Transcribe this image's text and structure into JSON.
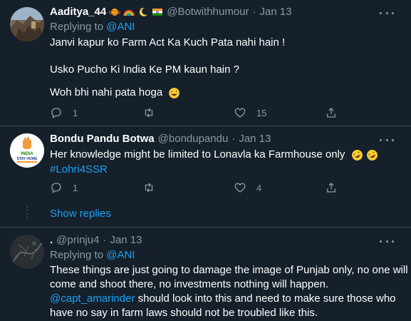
{
  "tweets": [
    {
      "display_name": "Aaditya_44",
      "name_emojis": [
        "ringed-planet",
        "rainbow",
        "crescent-moon",
        "india-flag"
      ],
      "handle": "@Botwithhumour",
      "date": "Jan 13",
      "replying_label": "Replying to",
      "replying_to": "@ANI",
      "lines": [
        "Janvi kapur ko Farm Act Ka Kuch Pata nahi hain !",
        "Usko Pucho Ki India Ke PM kaun hain ?",
        "Woh bhi nahi pata hoga"
      ],
      "reply_count": "1",
      "retweet_count": "",
      "like_count": "15"
    },
    {
      "display_name": "Bondu Pandu Botwa",
      "handle": "@bondupandu",
      "date": "Jan 13",
      "avatar_text": [
        "INDIA",
        "STAY HOME"
      ],
      "line1": "Her knowledge might be limited to Lonavla ka Farmhouse only",
      "hashtag": "#Lohri4SSR",
      "reply_count": "1",
      "retweet_count": "",
      "like_count": "4"
    },
    {
      "display_name": ".",
      "handle": "@prinju4",
      "date": "Jan 13",
      "replying_label": "Replying to",
      "replying_to": "@ANI",
      "lines": [
        "These things are just going to damage the image of Punjab only, no one will",
        "come and shoot there, no investments nothing will happen."
      ],
      "mention": "@capt_amarinder",
      "mention_rest": " should look into this and need to make sure those who",
      "last_line": "have no say in farm laws should not be troubled like this."
    }
  ],
  "show_replies_label": "Show replies",
  "separator": "·",
  "colors": {
    "background": "#15202b",
    "text": "#ffffff",
    "muted": "#8899a6",
    "accent": "#1da1f2",
    "divider": "#38444d"
  },
  "icons": [
    "more-icon",
    "reply-icon",
    "retweet-icon",
    "like-icon",
    "share-icon",
    "laughing-emoji",
    "rofl-emoji"
  ]
}
